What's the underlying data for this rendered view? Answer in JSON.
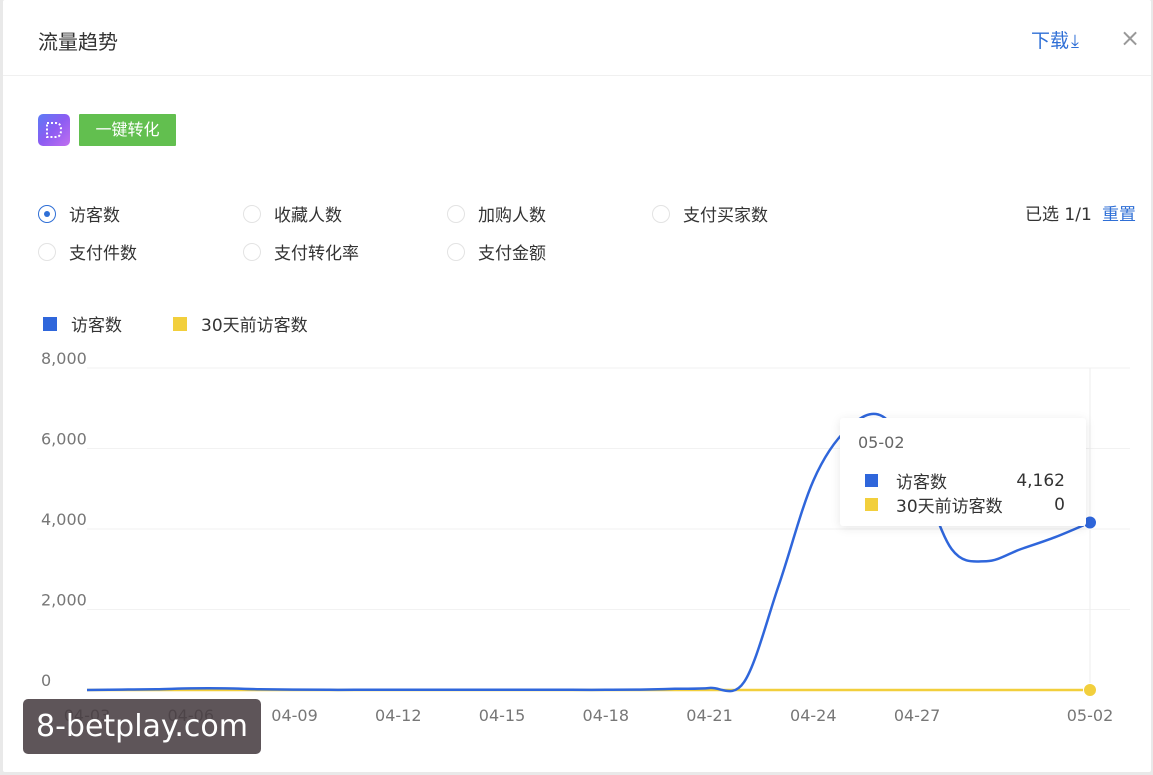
{
  "modal": {
    "title": "流量趋势",
    "download_label": "下载",
    "download_icon": "download-icon",
    "close_label": "×"
  },
  "toolbar": {
    "logo_icon": "app-logo-icon",
    "convert_label": "一键转化"
  },
  "metrics": [
    {
      "label": "访客数",
      "checked": true
    },
    {
      "label": "收藏人数",
      "checked": false
    },
    {
      "label": "加购人数",
      "checked": false
    },
    {
      "label": "支付买家数",
      "checked": false
    },
    {
      "label": "支付件数",
      "checked": false
    },
    {
      "label": "支付转化率",
      "checked": false
    },
    {
      "label": "支付金额",
      "checked": false
    }
  ],
  "selection": {
    "count_label": "已选 1/1",
    "reset_label": "重置"
  },
  "colors": {
    "accent": "#2f6fd6",
    "series_current": "#2f66db",
    "series_previous": "#f2cf3c",
    "convert_button": "#62bf4f"
  },
  "chart_data": {
    "type": "line",
    "x": [
      "04-03",
      "04-04",
      "04-05",
      "04-06",
      "04-07",
      "04-08",
      "04-09",
      "04-10",
      "04-11",
      "04-12",
      "04-13",
      "04-14",
      "04-15",
      "04-16",
      "04-17",
      "04-18",
      "04-19",
      "04-20",
      "04-21",
      "04-22",
      "04-23",
      "04-24",
      "04-25",
      "04-26",
      "04-27",
      "04-28",
      "04-29",
      "04-30",
      "05-01",
      "05-02"
    ],
    "tick_labels": [
      "04-03",
      "04-06",
      "04-09",
      "04-12",
      "04-15",
      "04-18",
      "04-21",
      "04-24",
      "04-27",
      "05-02"
    ],
    "series": [
      {
        "name": "访客数",
        "values": [
          0,
          10,
          20,
          40,
          40,
          20,
          10,
          5,
          5,
          5,
          5,
          5,
          5,
          5,
          5,
          5,
          10,
          30,
          50,
          200,
          2600,
          5200,
          6500,
          6800,
          5500,
          3500,
          3200,
          3500,
          3800,
          4162
        ]
      },
      {
        "name": "30天前访客数",
        "values": [
          0,
          0,
          0,
          0,
          0,
          0,
          0,
          0,
          0,
          0,
          0,
          0,
          0,
          0,
          0,
          0,
          0,
          0,
          0,
          0,
          0,
          0,
          0,
          0,
          0,
          0,
          0,
          0,
          0,
          0
        ]
      }
    ],
    "ylim": [
      0,
      8000
    ],
    "yticks": [
      "0",
      "2,000",
      "4,000",
      "6,000",
      "8,000"
    ],
    "grid": true,
    "legend": "top-left"
  },
  "tooltip": {
    "date": "05-02",
    "rows": [
      {
        "label": "访客数",
        "value": "4,162"
      },
      {
        "label": "30天前访客数",
        "value": "0"
      }
    ]
  },
  "watermark": {
    "text": "8-betplay.com"
  }
}
